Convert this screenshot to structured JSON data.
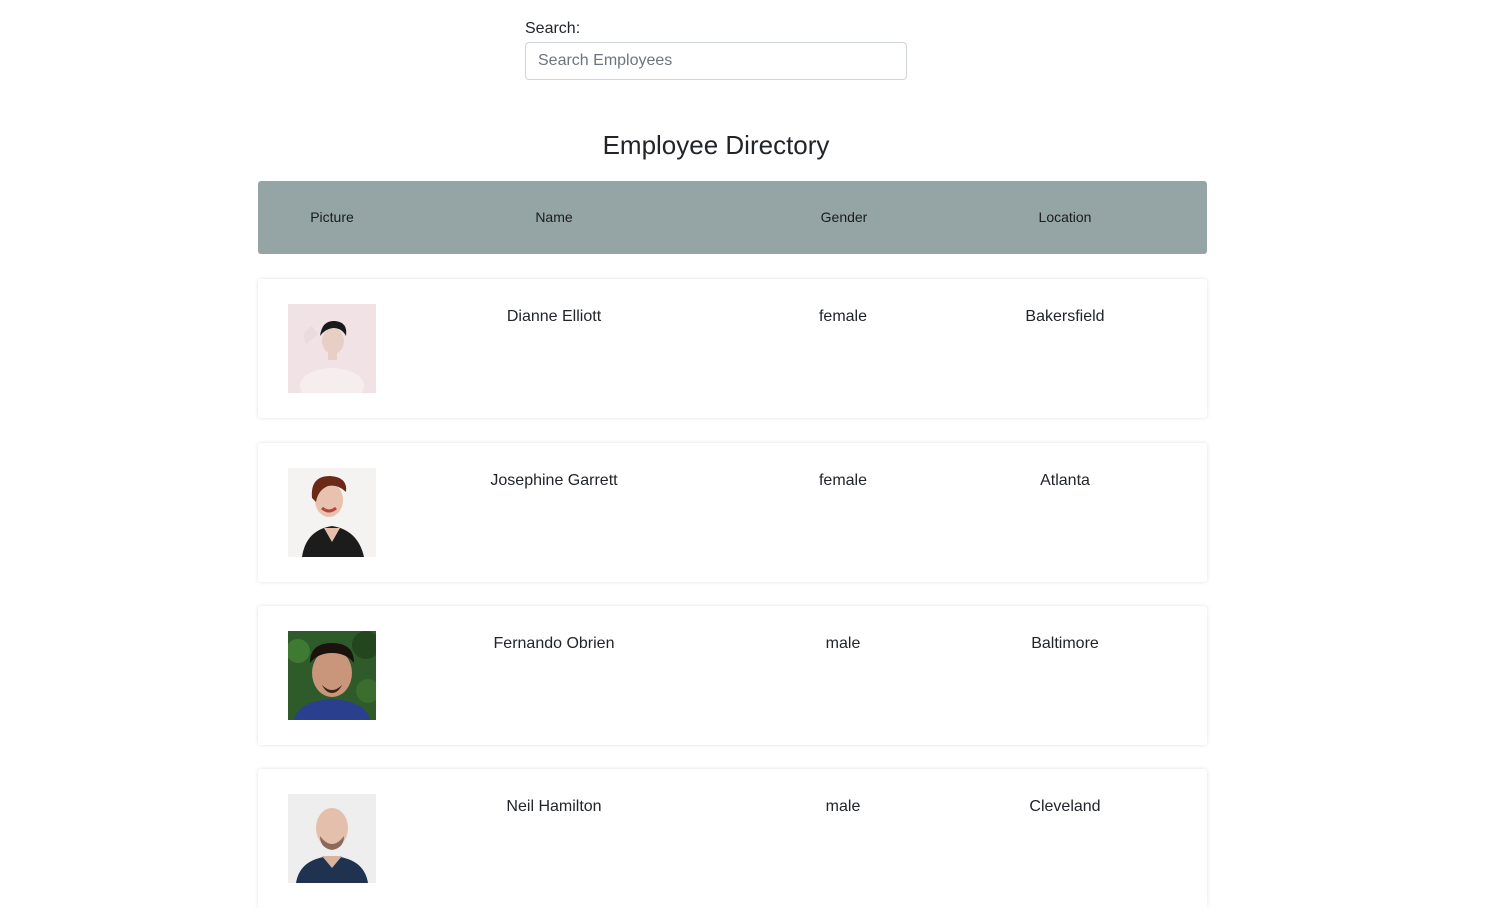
{
  "search": {
    "label": "Search:",
    "placeholder": "Search Employees",
    "value": ""
  },
  "page": {
    "title": "Employee Directory"
  },
  "table": {
    "headers": [
      "Picture",
      "Name",
      "Gender",
      "Location"
    ],
    "rows": [
      {
        "name": "Dianne Elliott",
        "gender": "female",
        "location": "Bakersfield",
        "avatar": "portrait-photo"
      },
      {
        "name": "Josephine Garrett",
        "gender": "female",
        "location": "Atlanta",
        "avatar": "portrait-photo"
      },
      {
        "name": "Fernando Obrien",
        "gender": "male",
        "location": "Baltimore",
        "avatar": "portrait-photo"
      },
      {
        "name": "Neil Hamilton",
        "gender": "male",
        "location": "Cleveland",
        "avatar": "portrait-photo"
      }
    ]
  },
  "colors": {
    "header_bg": "#95a5a6",
    "page_bg": "#ffffff",
    "text": "#212529"
  }
}
